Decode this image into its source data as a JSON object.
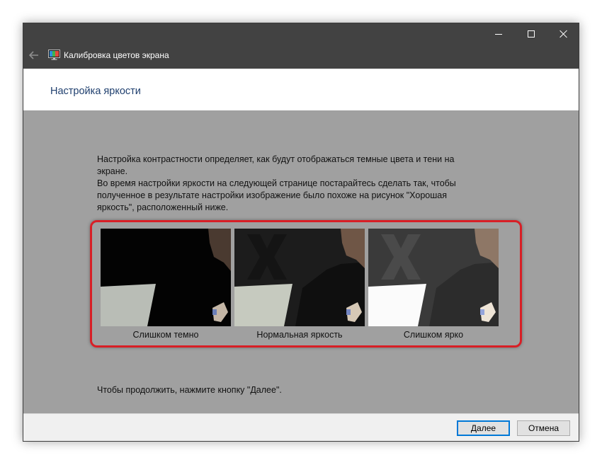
{
  "window": {
    "title": "Калибровка цветов экрана",
    "icons": {
      "back": "back-arrow-icon",
      "app": "display-calibration-icon",
      "minimize": "minimize-icon",
      "maximize": "maximize-icon",
      "close": "close-icon"
    }
  },
  "header": {
    "title": "Настройка яркости"
  },
  "content": {
    "intro_line1": "Настройка контрастности определяет, как будут отображаться темные цвета и тени на экране.",
    "intro_line2": "Во время настройки яркости на следующей странице постарайтесь сделать так, чтобы полученное в результате настройки изображение было похоже на рисунок \"Хорошая яркость\", расположенный ниже.",
    "samples": [
      {
        "caption": "Слишком темно"
      },
      {
        "caption": "Нормальная яркость"
      },
      {
        "caption": "Слишком ярко"
      }
    ],
    "continue_text": "Чтобы продолжить, нажмите кнопку \"Далее\"."
  },
  "footer": {
    "next_label": "Далее",
    "cancel_label": "Отмена"
  },
  "colors": {
    "accent": "#0078d7",
    "highlight_frame": "#d81f26",
    "title_bar": "#424242",
    "page_title": "#1f3f6e",
    "content_bg": "#a0a0a0"
  }
}
